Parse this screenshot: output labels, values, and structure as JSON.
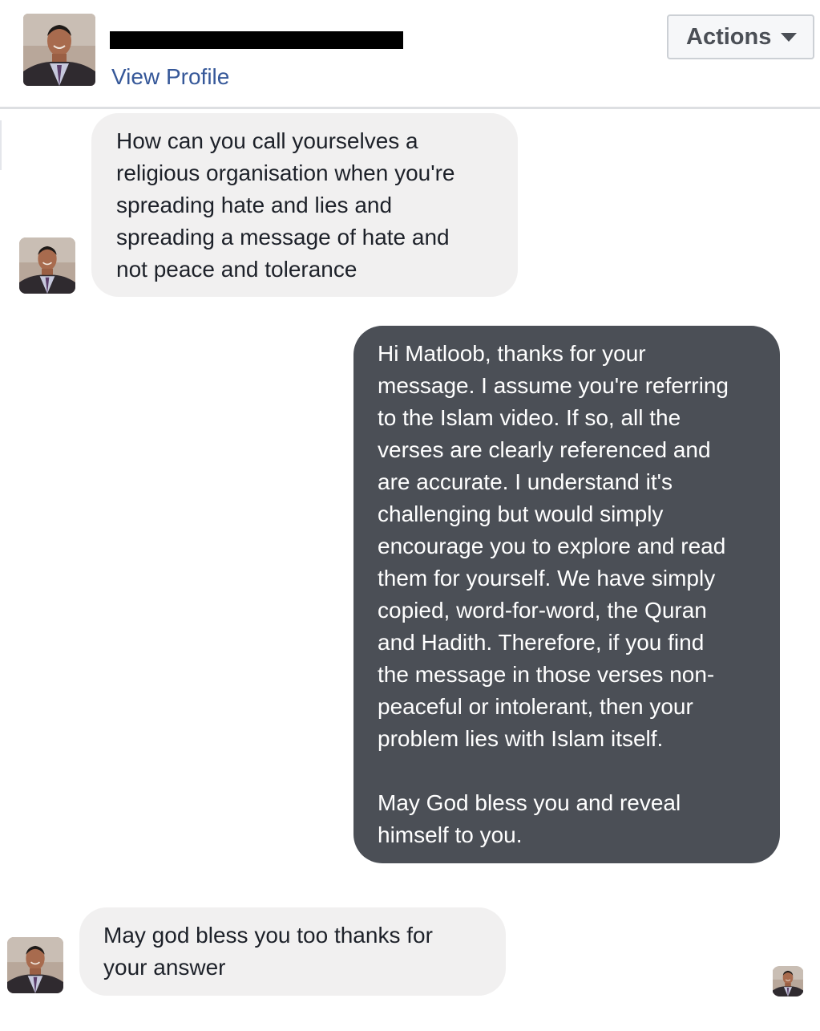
{
  "header": {
    "view_profile_label": "View Profile",
    "actions_label": "Actions"
  },
  "messages": [
    {
      "direction": "incoming",
      "text": "How can you call yourselves a\nreligious organisation when you're\nspreading hate and lies and\nspreading a message of hate and\nnot peace and tolerance"
    },
    {
      "direction": "outgoing",
      "text": "Hi Matloob, thanks for your\nmessage. I assume you're referring\nto the Islam video. If so, all the\nverses are clearly referenced and\nare accurate. I understand it's\nchallenging but would simply\nencourage you to explore and read\nthem for yourself. We have simply\ncopied, word-for-word, the Quran\nand Hadith. Therefore, if you find\nthe message in those verses non-\npeaceful or intolerant, then your\nproblem lies with Islam itself.\n\nMay God bless you and reveal\nhimself to you."
    },
    {
      "direction": "incoming",
      "text": "May god bless you too thanks for\nyour answer"
    }
  ],
  "colors": {
    "incoming_bubble": "#f1f0f0",
    "outgoing_bubble": "#4b4f56",
    "link": "#365899",
    "divider": "#dddfe2"
  },
  "icons": {
    "actions_caret": "caret-down-icon",
    "avatar": "user-photo-avatar",
    "redaction": "black-redaction-bar"
  }
}
